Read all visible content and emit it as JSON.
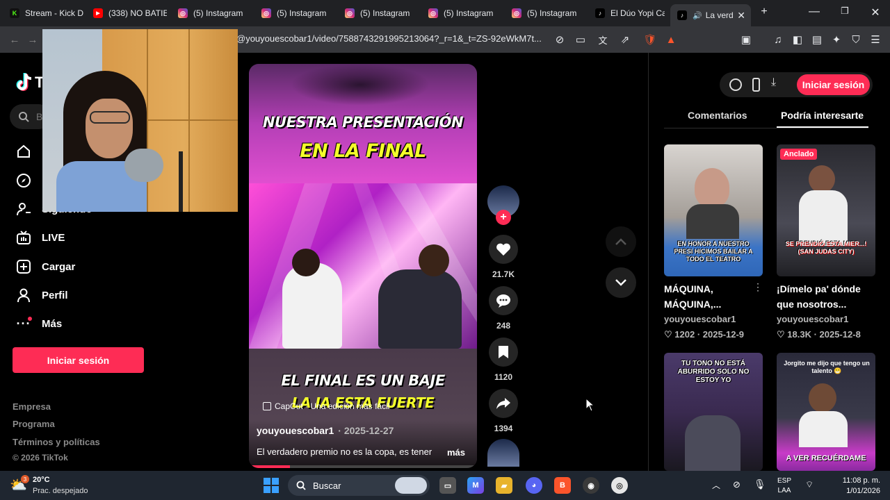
{
  "browser": {
    "tabs": [
      {
        "label": "Stream - Kick D",
        "icon": "kick-icon",
        "color": "#53fc18"
      },
      {
        "label": "(338) NO BATIE",
        "icon": "youtube-icon",
        "color": "#ff0000"
      },
      {
        "label": "(5) Instagram",
        "icon": "instagram-icon",
        "color": "#e1306c"
      },
      {
        "label": "(5) Instagram",
        "icon": "instagram-icon",
        "color": "#e1306c"
      },
      {
        "label": "(5) Instagram",
        "icon": "instagram-icon",
        "color": "#e1306c"
      },
      {
        "label": "(5) Instagram",
        "icon": "instagram-icon",
        "color": "#e1306c"
      },
      {
        "label": "(5) Instagram",
        "icon": "instagram-icon",
        "color": "#e1306c"
      },
      {
        "label": "El Dúo Yopi Ca",
        "icon": "tiktok-icon",
        "color": "#000000"
      },
      {
        "label": "La verd",
        "icon": "tiktok-icon",
        "color": "#000000",
        "active": true
      }
    ],
    "url": "@youyouescobar1/video/7588743291995213064?_r=1&_t=ZS-92eWkM7t..."
  },
  "sidebar": {
    "logo": "T",
    "search_placeholder": "B",
    "items": [
      {
        "label": "",
        "icon": "home-icon"
      },
      {
        "label": "",
        "icon": "explore-icon"
      },
      {
        "label": "Siguiendo",
        "icon": "following-icon"
      },
      {
        "label": "LIVE",
        "icon": "live-icon"
      },
      {
        "label": "Cargar",
        "icon": "upload-icon"
      },
      {
        "label": "Perfil",
        "icon": "profile-icon"
      },
      {
        "label": "Más",
        "icon": "more-icon"
      }
    ],
    "login_button": "Iniciar sesión",
    "footer": [
      "Empresa",
      "Programa",
      "Términos y políticas"
    ],
    "copyright": "© 2026 TikTok"
  },
  "video": {
    "caption_top_1": "NUESTRA PRESENTACIÓN",
    "caption_top_2": "EN LA FINAL",
    "caption_bottom_1": "EL FINAL ES UN BAJE",
    "caption_bottom_2": "LA IA ESTA FUERTE",
    "capcut": "CapCut · Una edición más fácil",
    "author": "youyouescobar1",
    "date": "· 2025-12-27",
    "description": "El verdadero premio no es la copa, es tener",
    "more": "más",
    "progress": 0.18
  },
  "actions": {
    "likes": "21.7K",
    "comments": "248",
    "saves": "1120",
    "shares": "1394"
  },
  "right_panel": {
    "tab_comments": "Comentarios",
    "tab_interest": "Podría interesarte",
    "login_button": "Iniciar sesión",
    "cards": [
      {
        "title": "MÁQUINA, MÁQUINA,...",
        "author": "youyouescobar1",
        "likes": "1202",
        "date": "· 2025-12-9",
        "thumb_text": "EN HONOR A NUESTRO PRESI HICIMOS BAILAR A TODO EL TEATRO",
        "badge": ""
      },
      {
        "title": "¡Dímelo pa' dónde que nosotros...",
        "author": "youyouescobar1",
        "likes": "18.3K",
        "date": "· 2025-12-8",
        "thumb_text": "SE PRENDIÓ ESTA MIER...! (SAN JUDAS CITY)",
        "badge": "Anclado"
      },
      {
        "title": "",
        "author": "",
        "likes": "",
        "date": "",
        "thumb_text": "TU TONO NO ESTÁ ABURRIDO SOLO NO ESTOY YO",
        "badge": ""
      },
      {
        "title": "",
        "author": "",
        "likes": "",
        "date": "",
        "thumb_text": "Jorgito me dijo que tengo un talento 😁",
        "badge": "",
        "thumb_text_2": "A VER RECUÉRDAME"
      }
    ]
  },
  "taskbar": {
    "weather_temp": "20°C",
    "weather_desc": "Prac. despejado",
    "weather_badge": "3",
    "search_label": "Buscar",
    "lang_1": "ESP",
    "lang_2": "LAA",
    "time": "11:08 p. m.",
    "date": "1/01/2026"
  }
}
